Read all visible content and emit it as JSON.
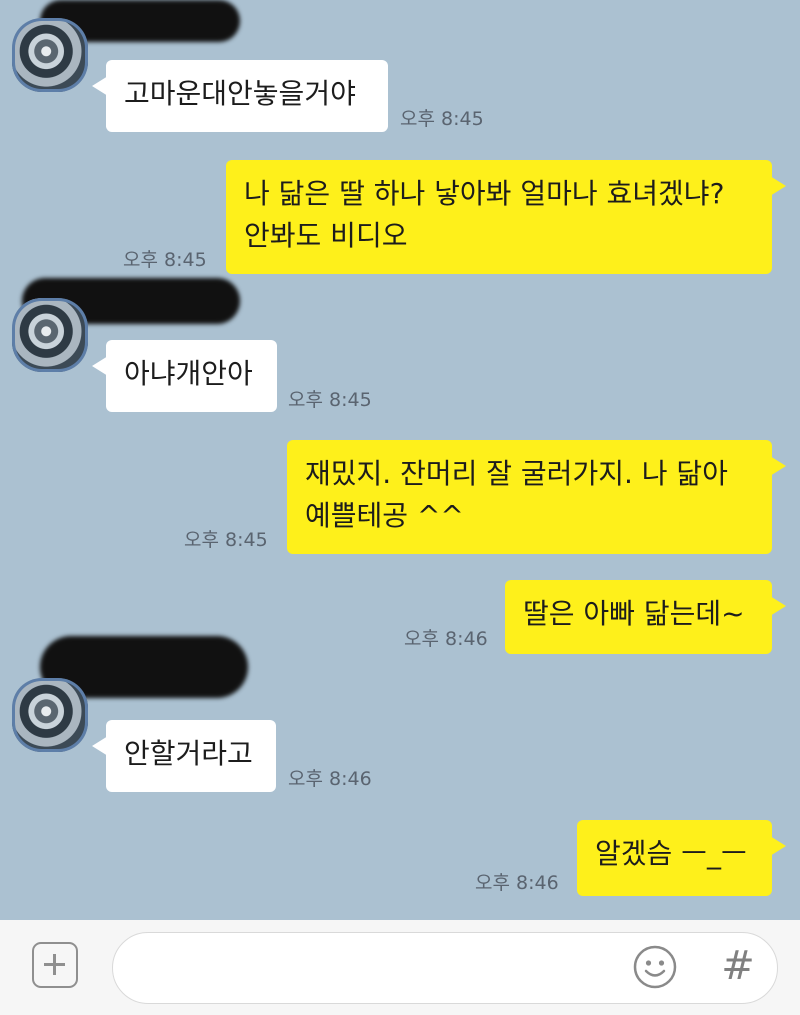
{
  "messages": [
    {
      "dir": "in",
      "text": "고마운대안놓을거야",
      "time": "오후 8:45"
    },
    {
      "dir": "out",
      "text": "나 닮은 딸 하나 낳아봐 얼마나 효녀겠냐? 안봐도 비디오",
      "time": "오후 8:45"
    },
    {
      "dir": "in",
      "text": "아냐개안아",
      "time": "오후 8:45"
    },
    {
      "dir": "out",
      "text": "재밌지. 잔머리 잘 굴러가지. 나 닮아 예쁠테공 ^^",
      "time": "오후 8:45"
    },
    {
      "dir": "out",
      "text": "딸은 아빠 닮는데~",
      "time": "오후 8:46"
    },
    {
      "dir": "in",
      "text": "안할거라고",
      "time": "오후 8:46"
    },
    {
      "dir": "out",
      "text": "알겠슴 ㅡ_ㅡ",
      "time": "오후 8:46"
    }
  ],
  "input_bar": {
    "placeholder": "",
    "icons": [
      "plus-icon",
      "emoji-icon",
      "hash-icon"
    ],
    "hash_glyph": "#"
  },
  "colors": {
    "background": "#abc1d1",
    "incoming_bubble": "#ffffff",
    "outgoing_bubble": "#fef01b",
    "input_bar": "#f6f6f6"
  }
}
